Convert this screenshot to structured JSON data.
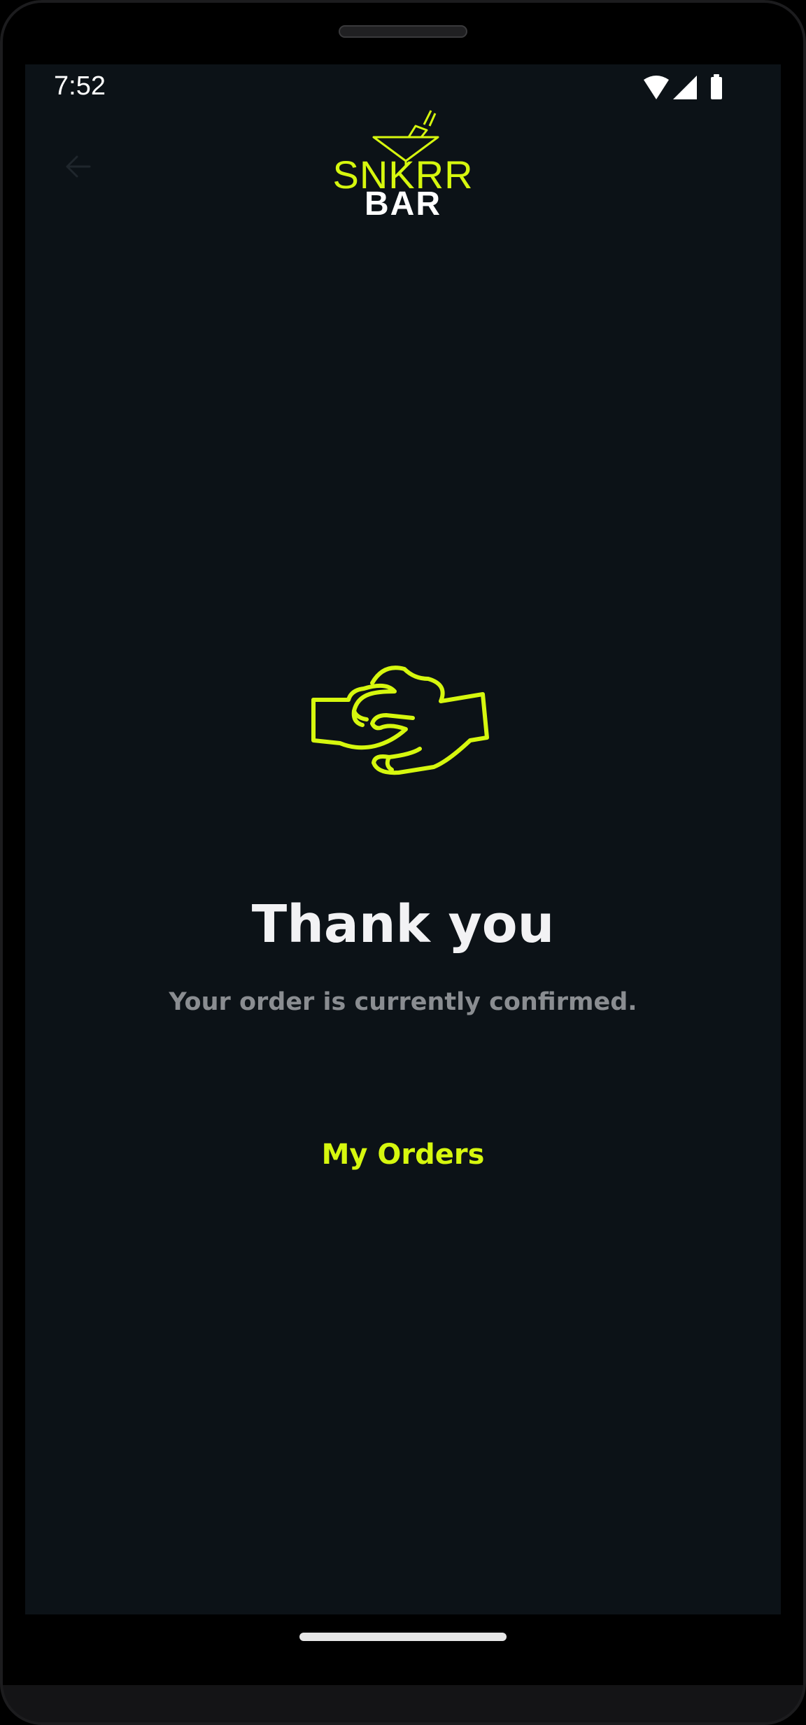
{
  "status_bar": {
    "time": "7:52",
    "icons": [
      "wifi-icon",
      "cellular-signal-icon",
      "battery-icon"
    ]
  },
  "header": {
    "back_icon": "arrow-left-icon",
    "logo": {
      "line1": "SNKRR",
      "line2": "BAR",
      "icon": "cocktail-glass-icon"
    }
  },
  "confirmation": {
    "illustration": "handshake-icon",
    "title": "Thank you",
    "message": "Your order is currently confirmed.",
    "action_label": "My Orders"
  },
  "colors": {
    "accent": "#d6f70e",
    "background": "#0c1217",
    "title_text": "#f2f2f4",
    "secondary_text": "#8a8d91"
  }
}
